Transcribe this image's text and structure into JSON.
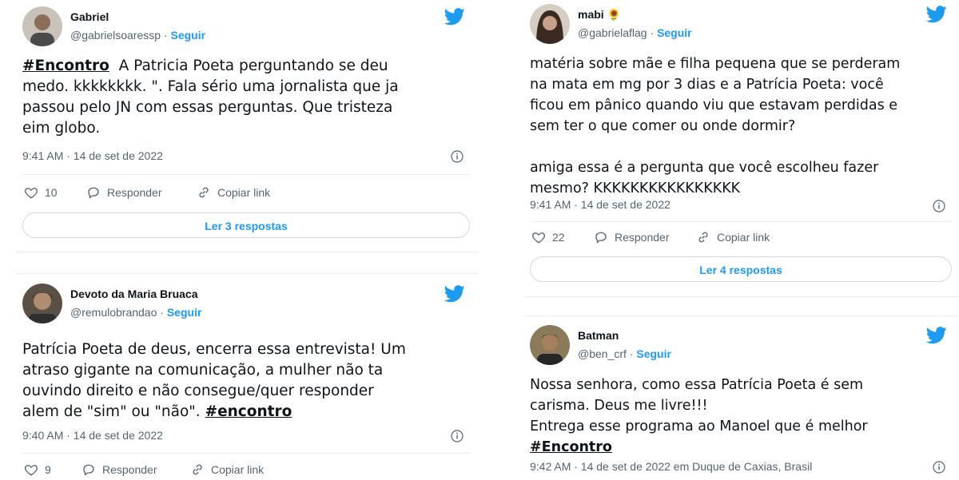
{
  "colors": {
    "accent": "#1d9bf0",
    "text": "#0f1419",
    "muted": "#536471",
    "border": "#cfd9de"
  },
  "tweets": [
    {
      "name": "Gabriel",
      "handle": "@gabrielsoaressp",
      "sep": " · ",
      "follow": "Seguir",
      "text_hashtag": "#Encontro",
      "text_rest": "  A Patricia Poeta perguntando se deu\nmedo. kkkkkkkk. \". Fala sério uma jornalista que ja\npassou pelo JN com essas perguntas. Que tristeza\neim globo.",
      "timestamp": "9:41 AM · 14 de set de 2022",
      "likes": "10",
      "reply_label": "Responder",
      "copy_label": "Copiar link",
      "replies_button": "Ler 3 respostas",
      "icon": "twitter-bird-icon"
    },
    {
      "name": "mabi 🌻",
      "handle": "@gabrielaflag",
      "sep": " · ",
      "follow": "Seguir",
      "text": "matéria sobre mãe e filha pequena que se perderam\nna mata em mg por 3 dias e a Patrícia Poeta: você\nficou em pânico quando viu que estavam perdidas e\nsem ter o que comer ou onde dormir?\n\namiga essa é a pergunta que você escolheu fazer\nmesmo? KKKKKKKKKKKKKKKK",
      "timestamp": "9:41 AM · 14 de set de 2022",
      "likes": "22",
      "reply_label": "Responder",
      "copy_label": "Copiar link",
      "replies_button": "Ler 4 respostas",
      "icon": "twitter-bird-icon"
    },
    {
      "name": "Devoto da Maria Bruaca",
      "handle": "@remulobrandao",
      "sep": " · ",
      "follow": "Seguir",
      "text_main": "Patrícia Poeta de deus, encerra essa entrevista! Um\natraso gigante na comunicação, a mulher não ta\nouvindo direito e não consegue/quer responder\nalem de \"sim\" ou \"não\". ",
      "text_hashtag": "#encontro",
      "timestamp": "9:40 AM · 14 de set de 2022",
      "likes": "9",
      "reply_label": "Responder",
      "copy_label": "Copiar link",
      "icon": "twitter-bird-icon"
    },
    {
      "name": "Batman",
      "handle": "@ben_crf",
      "sep": " · ",
      "follow": "Seguir",
      "text_main": "Nossa senhora, como essa Patrícia Poeta é sem\ncarisma. Deus me livre!!!\nEntrega esse programa ao Manoel que é melhor\n",
      "text_hashtag": "#Encontro",
      "timestamp": "9:42 AM · 14 de set de 2022 em Duque de Caxias, Brasil",
      "icon": "twitter-bird-icon"
    }
  ]
}
